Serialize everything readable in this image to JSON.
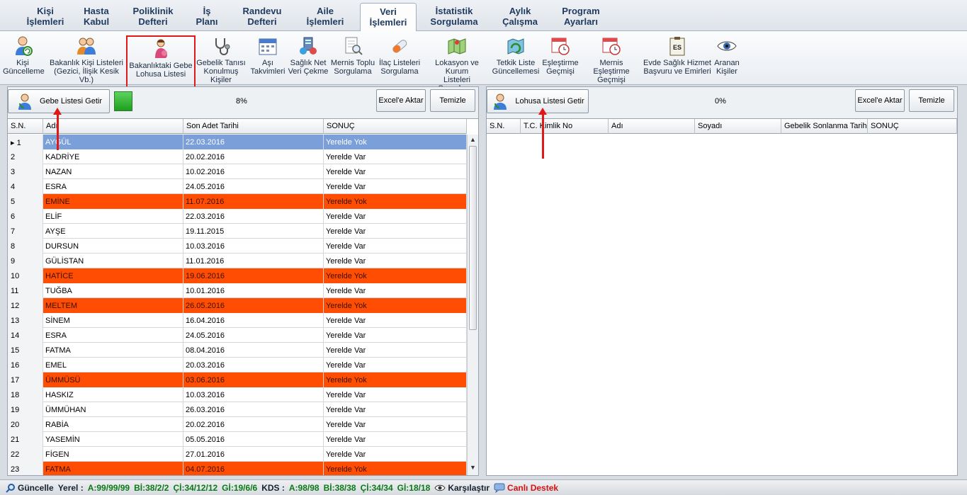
{
  "menu": {
    "tabs": [
      {
        "line1": "Kişi",
        "line2": "İşlemleri"
      },
      {
        "line1": "Hasta",
        "line2": "Kabul"
      },
      {
        "line1": "Poliklinik",
        "line2": "Defteri"
      },
      {
        "line1": "İş",
        "line2": "Planı"
      },
      {
        "line1": "Randevu",
        "line2": "Defteri"
      },
      {
        "line1": "Aile",
        "line2": "İşlemleri"
      },
      {
        "line1": "Veri",
        "line2": "İşlemleri"
      },
      {
        "line1": "İstatistik",
        "line2": "Sorgulama"
      },
      {
        "line1": "Aylık",
        "line2": "Çalışma"
      },
      {
        "line1": "Program",
        "line2": "Ayarları"
      }
    ]
  },
  "ribbon": {
    "items": [
      {
        "line1": "Kişi",
        "line2": "Güncelleme",
        "icon": "person-refresh-icon"
      },
      {
        "line1": "Bakanlık Kişi Listeleri",
        "line2": "(Gezici, İlişik Kesik Vb.)",
        "icon": "people-icon"
      },
      {
        "line1": "Bakanlıktaki Gebe",
        "line2": "Lohusa Listesi",
        "icon": "pregnant-woman-icon"
      },
      {
        "line1": "Gebelik Tanısı",
        "line2": "Konulmuş Kişiler",
        "icon": "stethoscope-icon"
      },
      {
        "line1": "Aşı",
        "line2": "Takvimleri",
        "icon": "calendar-icon"
      },
      {
        "line1": "Sağlık Net",
        "line2": "Veri Çekme",
        "icon": "network-icon"
      },
      {
        "line1": "Mernis Toplu",
        "line2": "Sorgulama",
        "icon": "document-search-icon"
      },
      {
        "line1": "İlaç Listeleri",
        "line2": "Sorgulama",
        "icon": "pill-icon"
      },
      {
        "line1": "Lokasyon ve Kurum",
        "line2": "Listeleri Sorgulama",
        "icon": "map-icon"
      },
      {
        "line1": "Tetkik Liste",
        "line2": "Güncellemesi",
        "icon": "map-refresh-icon"
      },
      {
        "line1": "Eşleştirme",
        "line2": "Geçmişi",
        "icon": "calendar-clock-icon"
      },
      {
        "line1": "Mernis Eşleştirme",
        "line2": "Geçmişi",
        "icon": "calendar-clock-icon"
      },
      {
        "line1": "Evde Sağlık Hizmet",
        "line2": "Başvuru ve Emirleri",
        "icon": "clipboard-es-icon"
      },
      {
        "line1": "Aranan",
        "line2": "Kişiler",
        "icon": "eye-icon"
      }
    ],
    "es_label": "ES"
  },
  "left_panel": {
    "fetch_label": "Gebe Listesi Getir",
    "progress": "8%",
    "excel_label": "Excel'e Aktar",
    "clear_label": "Temizle",
    "columns": [
      "S.N.",
      "Adı",
      "Son Adet Tarihi",
      "SONUÇ"
    ],
    "rows": [
      {
        "sn": "1",
        "name": "AYGÜL",
        "date": "22.03.2016",
        "result": "Yerelde Yok"
      },
      {
        "sn": "2",
        "name": "KADRİYE",
        "date": "20.02.2016",
        "result": "Yerelde Var"
      },
      {
        "sn": "3",
        "name": "NAZAN",
        "date": "10.02.2016",
        "result": "Yerelde Var"
      },
      {
        "sn": "4",
        "name": "ESRA",
        "date": "24.05.2016",
        "result": "Yerelde Var"
      },
      {
        "sn": "5",
        "name": "EMİNE",
        "date": "11.07.2016",
        "result": "Yerelde Yok"
      },
      {
        "sn": "6",
        "name": "ELİF",
        "date": "22.03.2016",
        "result": "Yerelde Var"
      },
      {
        "sn": "7",
        "name": "AYŞE",
        "date": "19.11.2015",
        "result": "Yerelde Var"
      },
      {
        "sn": "8",
        "name": "DURSUN",
        "date": "10.03.2016",
        "result": "Yerelde Var"
      },
      {
        "sn": "9",
        "name": "GÜLİSTAN",
        "date": "11.01.2016",
        "result": "Yerelde Var"
      },
      {
        "sn": "10",
        "name": "HATİCE",
        "date": "19.06.2016",
        "result": "Yerelde Yok"
      },
      {
        "sn": "11",
        "name": "TUĞBA",
        "date": "10.01.2016",
        "result": "Yerelde Var"
      },
      {
        "sn": "12",
        "name": "MELTEM",
        "date": "26.05.2016",
        "result": "Yerelde Yok"
      },
      {
        "sn": "13",
        "name": "SİNEM",
        "date": "16.04.2016",
        "result": "Yerelde Var"
      },
      {
        "sn": "14",
        "name": "ESRA",
        "date": "24.05.2016",
        "result": "Yerelde Var"
      },
      {
        "sn": "15",
        "name": "FATMA",
        "date": "08.04.2016",
        "result": "Yerelde Var"
      },
      {
        "sn": "16",
        "name": "EMEL",
        "date": "20.03.2016",
        "result": "Yerelde Var"
      },
      {
        "sn": "17",
        "name": "ÜMMÜSÜ",
        "date": "03.06.2016",
        "result": "Yerelde Yok"
      },
      {
        "sn": "18",
        "name": "HASKIZ",
        "date": "10.03.2016",
        "result": "Yerelde Var"
      },
      {
        "sn": "19",
        "name": "ÜMMÜHAN",
        "date": "26.03.2016",
        "result": "Yerelde Var"
      },
      {
        "sn": "20",
        "name": "RABİA",
        "date": "20.02.2016",
        "result": "Yerelde Var"
      },
      {
        "sn": "21",
        "name": "YASEMİN",
        "date": "05.05.2016",
        "result": "Yerelde Var"
      },
      {
        "sn": "22",
        "name": "FİGEN",
        "date": "27.01.2016",
        "result": "Yerelde Var"
      },
      {
        "sn": "23",
        "name": "FATMA",
        "date": "04.07.2016",
        "result": "Yerelde Yok"
      }
    ]
  },
  "right_panel": {
    "fetch_label": "Lohusa Listesi Getir",
    "progress": "0%",
    "excel_label": "Excel'e Aktar",
    "clear_label": "Temizle",
    "columns": [
      "S.N.",
      "T.C. Kimlik No",
      "Adı",
      "Soyadı",
      "Gebelik Sonlanma Tarihi",
      "SONUÇ"
    ]
  },
  "statusbar": {
    "guncelle": "Güncelle",
    "yerel_label": "Yerel :",
    "a1": "A:99/99/99",
    "b1": "Bİ:38/2/2",
    "c1": "Çİ:34/12/12",
    "g1": "Gİ:19/6/6",
    "kds_label": "KDS :",
    "a2": "A:98/98",
    "b2": "Bİ:38/38",
    "c2": "Çİ:34/34",
    "g2": "Gİ:18/18",
    "compare": "Karşılaştır",
    "support": "Canlı Destek"
  },
  "colors": {
    "row_missing": "#ff4d04",
    "row_selected": "#7a9fd9",
    "annotation": "#e01818"
  }
}
